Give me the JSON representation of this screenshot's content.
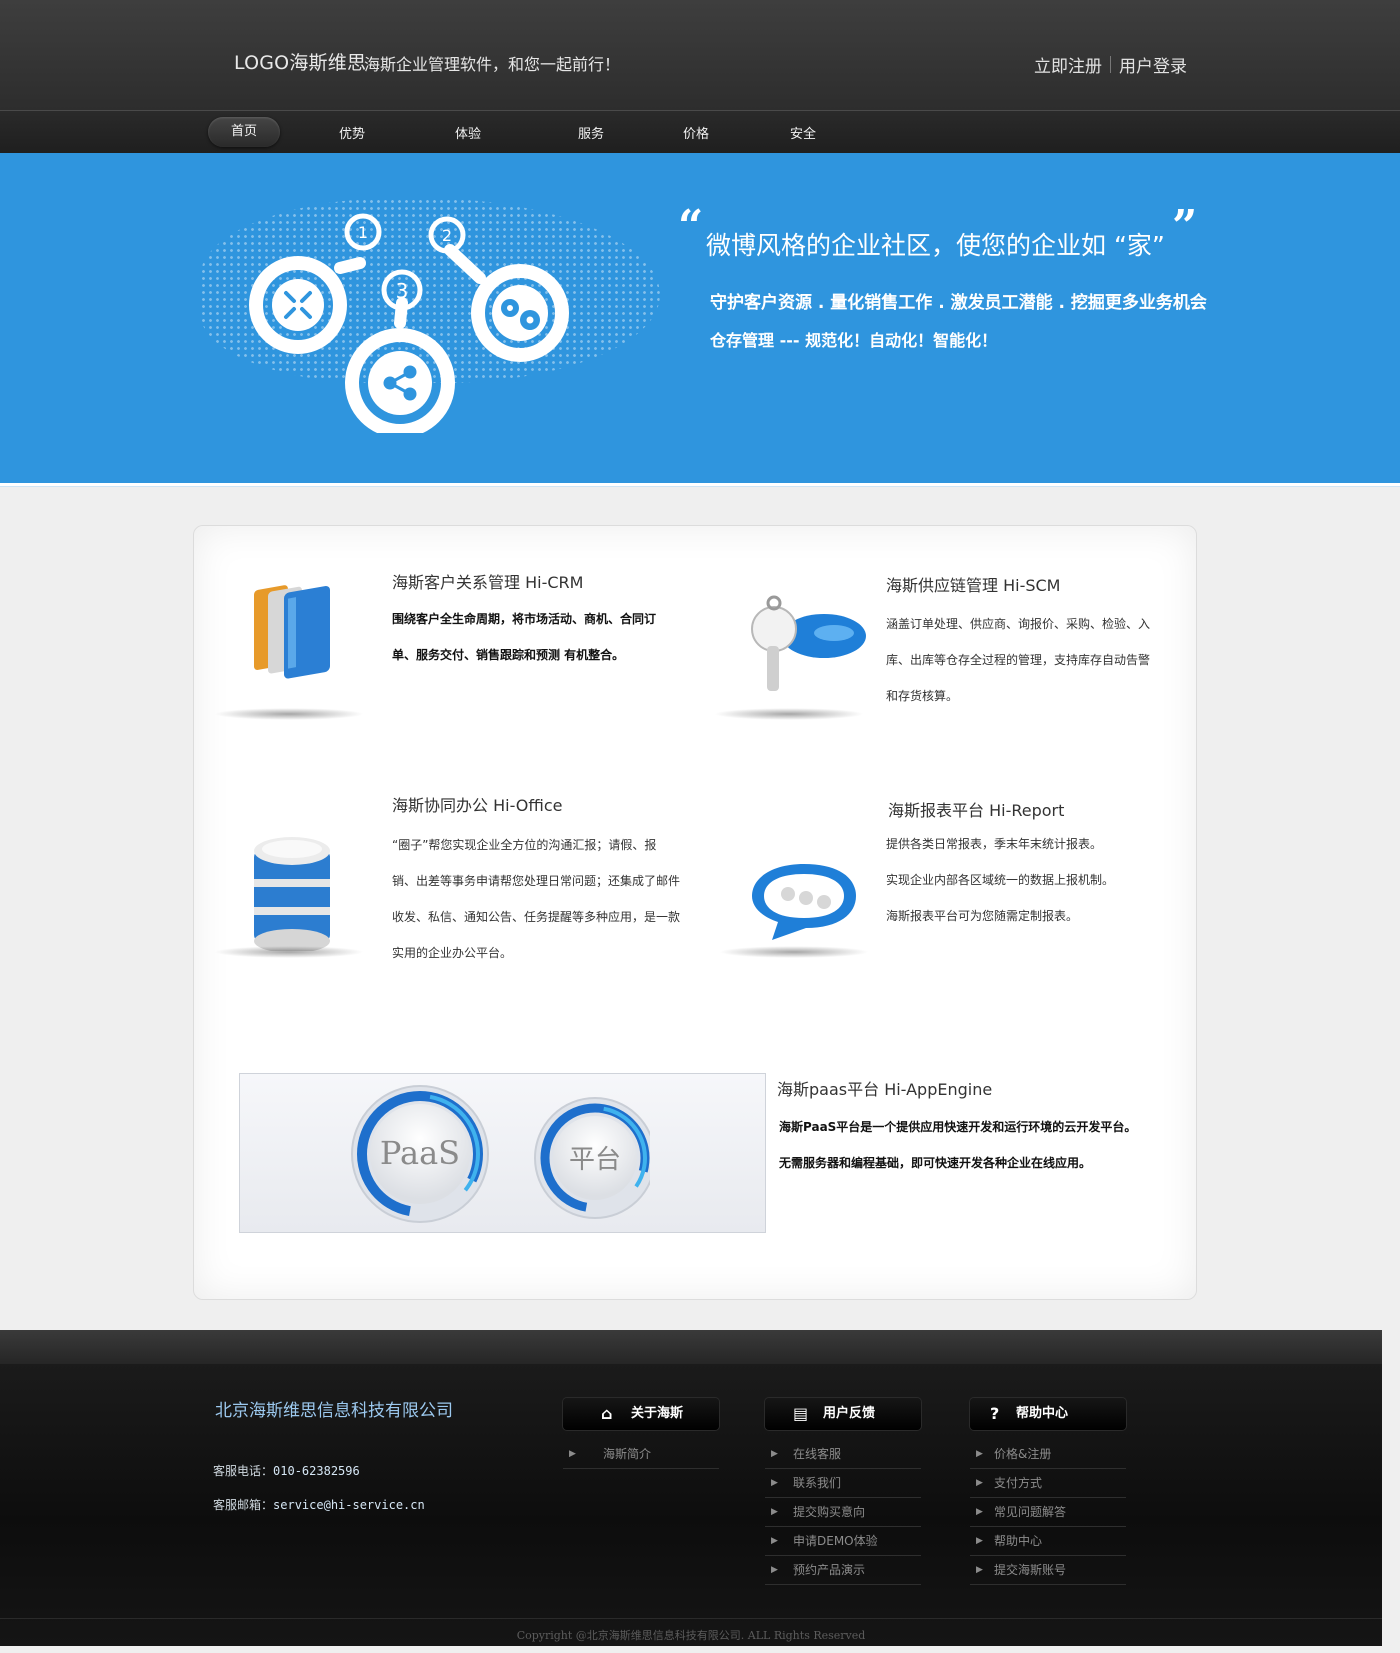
{
  "header": {
    "logo": "LOGO海斯维思",
    "slogan": "海斯企业管理软件，和您一起前行！",
    "register": "立即注册",
    "login": "用户登录"
  },
  "nav": {
    "items": [
      {
        "label": "首页"
      },
      {
        "label": "优势"
      },
      {
        "label": "体验"
      },
      {
        "label": "服务"
      },
      {
        "label": "价格"
      },
      {
        "label": "安全"
      }
    ]
  },
  "banner": {
    "title": "微博风格的企业社区，使您的企业如 “家”",
    "line1": "守护客户资源 . 量化销售工作 . 激发员工潜能 . 挖掘更多业务机会",
    "line2": "仓存管理 --- 规范化！自动化！智能化！",
    "step_numbers": [
      "1",
      "2",
      "3"
    ]
  },
  "products": {
    "crm": {
      "title": "海斯客户关系管理  Hi-CRM",
      "line1": "围绕客户全生命周期，将市场活动、商机、合同订",
      "line2": "单、服务交付、销售跟踪和预测 有机整合。"
    },
    "scm": {
      "title": "海斯供应链管理  Hi-SCM",
      "line1": "涵盖订单处理、供应商、询报价、采购、检验、入",
      "line2": "库、出库等仓存全过程的管理，支持库存自动告警",
      "line3": "和存货核算。"
    },
    "office": {
      "title": "海斯协同办公 Hi-Office",
      "line1": "“圈子”帮您实现企业全方位的沟通汇报；请假、报",
      "line2": "销、出差等事务申请帮您处理日常问题；还集成了邮件",
      "line3": "收发、私信、通知公告、任务提醒等多种应用，是一款",
      "line4": "实用的企业办公平台。"
    },
    "report": {
      "title": "海斯报表平台 Hi-Report",
      "line1": "提供各类日常报表，季末年末统计报表。",
      "line2": "实现企业内部各区域统一的数据上报机制。",
      "line3": "海斯报表平台可为您随需定制报表。"
    },
    "paas": {
      "title": "海斯paas平台 Hi-AppEngine",
      "line1": "海斯PaaS平台是一个提供应用快速开发和运行环境的云开发平台。",
      "line2": "无需服务器和编程基础，即可快速开发各种企业在线应用。",
      "badge1": "PaaS",
      "badge2": "平台"
    }
  },
  "footer": {
    "company": "北京海斯维思信息科技有限公司",
    "phone_label": "客服电话：",
    "phone": "010-62382596",
    "email_label": "客服邮箱：",
    "email": "service@hi-service.cn",
    "columns": [
      {
        "title": "关于海斯",
        "icon": "home-icon",
        "items": [
          "海斯简介"
        ]
      },
      {
        "title": "用户反馈",
        "icon": "document-icon",
        "items": [
          "在线客服",
          "联系我们",
          "提交购买意向",
          "申请DEMO体验",
          "预约产品演示"
        ]
      },
      {
        "title": "帮助中心",
        "icon": "question-icon",
        "items": [
          "价格&注册",
          "支付方式",
          "常见问题解答",
          "帮助中心",
          "提交海斯账号"
        ]
      }
    ],
    "copyright": "Copyright @北京海斯维思信息科技有限公司. ALL Rights Reserved"
  },
  "colors": {
    "banner_blue": "#2f95de",
    "header_dark": "#333333",
    "footer_link": "#8c8c8c",
    "company_blue": "#9cc9ef"
  }
}
